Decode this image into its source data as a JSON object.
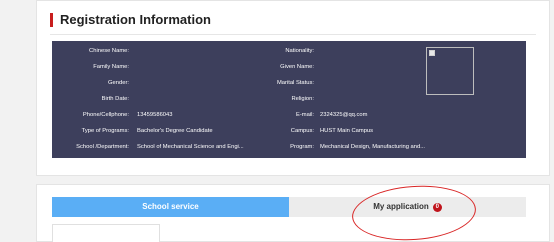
{
  "registration": {
    "title": "Registration Information",
    "rows": [
      {
        "label_left": "Chinese Name:",
        "value_left": "",
        "label_right": "Nationality:",
        "value_right": ""
      },
      {
        "label_left": "Family Name:",
        "value_left": "",
        "label_right": "Given Name:",
        "value_right": ""
      },
      {
        "label_left": "Gender:",
        "value_left": "",
        "label_right": "Marital Status:",
        "value_right": ""
      },
      {
        "label_left": "Birth Date:",
        "value_left": "",
        "label_right": "Religion:",
        "value_right": ""
      },
      {
        "label_left": "Phone/Cellphone:",
        "value_left": "13459586043",
        "label_right": "E-mail:",
        "value_right": "2324325@qq.com"
      },
      {
        "label_left": "Type of Programs:",
        "value_left": "Bachelor's Degree Candidate",
        "label_right": "Campus:",
        "value_right": "HUST Main Campus"
      },
      {
        "label_left": "School /Department:",
        "value_left": "School of Mechanical Science and Engi...",
        "label_right": "Program:",
        "value_right": "Mechanical Design, Manufacturing and..."
      }
    ],
    "photo_icon": "broken-image-icon"
  },
  "tabs": {
    "school_service": "School service",
    "my_application": "My application",
    "my_application_badge": "0"
  },
  "colors": {
    "panel_bg": "#3d3f5c",
    "tab_active": "#5aaef5",
    "accent_red": "#c81e1e"
  }
}
